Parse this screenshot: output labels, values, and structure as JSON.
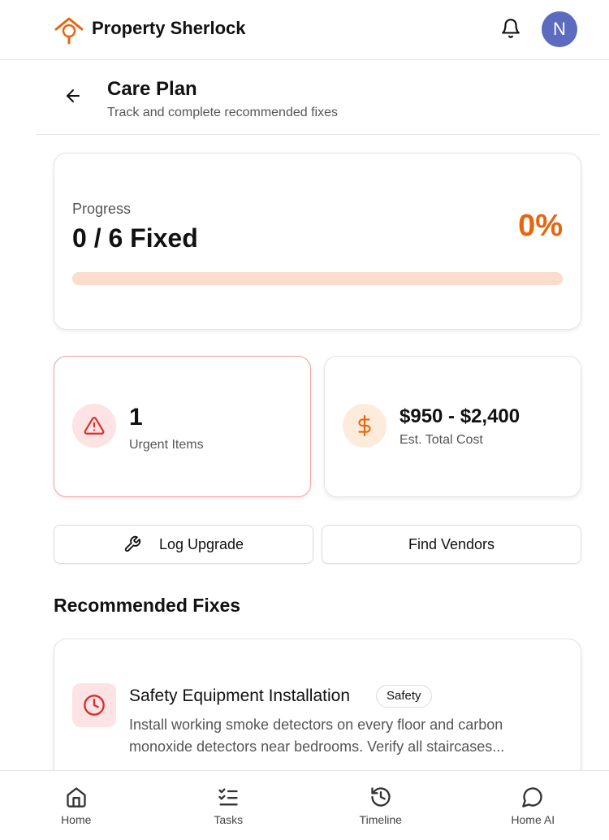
{
  "app": {
    "brand": "Property Sherlock",
    "avatar_initial": "N"
  },
  "header": {
    "title": "Care Plan",
    "subtitle": "Track and complete recommended fixes"
  },
  "progress": {
    "label": "Progress",
    "value": "0 / 6 Fixed",
    "percent_text": "0%",
    "percent": 0
  },
  "stats": {
    "urgent": {
      "value": "1",
      "label": "Urgent Items"
    },
    "cost": {
      "value": "$950 - $2,400",
      "label": "Est. Total Cost"
    }
  },
  "actions": {
    "log_upgrade": "Log Upgrade",
    "find_vendors": "Find Vendors"
  },
  "fixes": {
    "section_title": "Recommended Fixes",
    "items": [
      {
        "title": "Safety Equipment Installation",
        "badge": "Safety",
        "description": "Install working smoke detectors on every floor and carbon monoxide detectors near bedrooms. Verify all staircases..."
      }
    ]
  },
  "nav": {
    "items": [
      {
        "label": "Home",
        "icon": "home-icon"
      },
      {
        "label": "Tasks",
        "icon": "tasks-icon"
      },
      {
        "label": "Timeline",
        "icon": "history-icon"
      },
      {
        "label": "Home AI",
        "icon": "chat-icon"
      }
    ]
  },
  "colors": {
    "accent": "#e8650f",
    "urgent": "#d92d2d",
    "avatar": "#5b6bbf",
    "track": "#fcdccb"
  }
}
